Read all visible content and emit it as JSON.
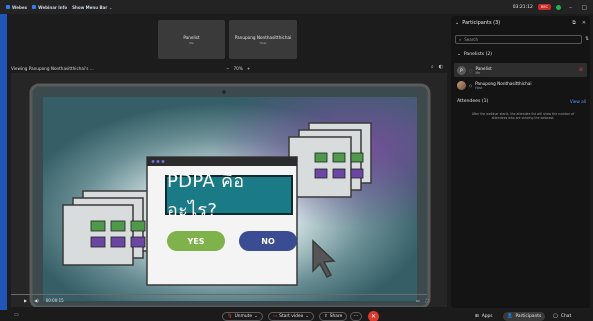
{
  "topbar": {
    "menu": [
      "Webex",
      "Webinar Info",
      "Show Menu Bar"
    ],
    "timer": "03:21:12",
    "rec_label": "REC"
  },
  "tiles": [
    {
      "name": "Panelist",
      "role": "Me"
    },
    {
      "name": "Panupong Nonthasitthichai",
      "role": "Host"
    }
  ],
  "share": {
    "viewing": "Viewing Panupong Nonthasitthichai's ...",
    "zoom": "70%"
  },
  "slide": {
    "question": "PDPA คืออะไร?",
    "yes": "YES",
    "no": "NO"
  },
  "video": {
    "time": "00:00:15"
  },
  "panel": {
    "title": "Participants (3)",
    "search_placeholder": "Search",
    "panelists_header": "Panelists (2)",
    "panelists": [
      {
        "name": "Panelist",
        "role": "Me",
        "initial": "P"
      },
      {
        "name": "Panupong Nonthasitthichai",
        "role": "Host",
        "initial": "P"
      }
    ],
    "attendees_header": "Attendees (1)",
    "view_all": "View all",
    "attendee_note": "After the webinar starts, the attendee list will show the number of attendees who are viewing the webcast."
  },
  "toolbar": {
    "unmute": "Unmute",
    "start_video": "Start video",
    "share": "Share",
    "apps": "Apps",
    "participants": "Participants",
    "chat": "Chat"
  }
}
